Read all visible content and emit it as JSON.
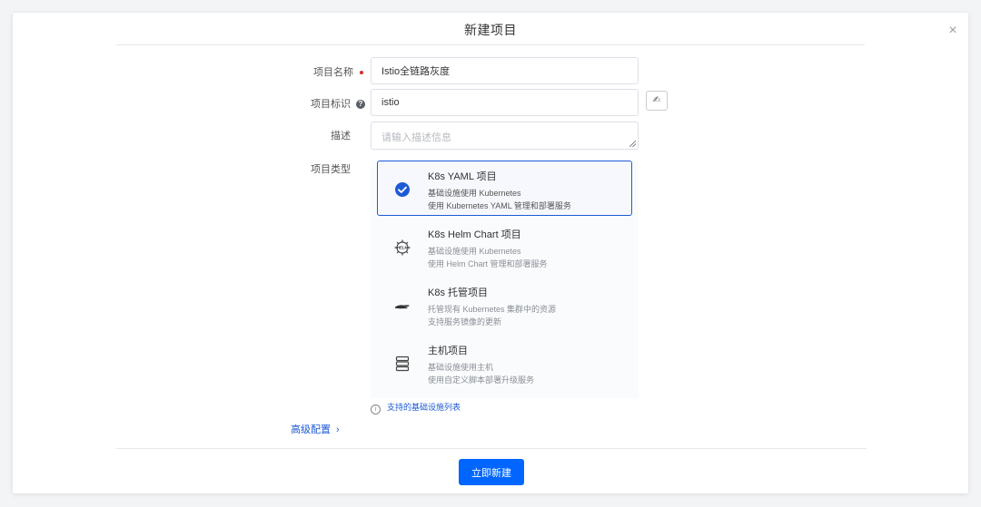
{
  "dialog": {
    "title": "新建项目",
    "close_icon": "×"
  },
  "form": {
    "name": {
      "label": "项目名称",
      "value": "Istio全链路灰度"
    },
    "key": {
      "label": "项目标识",
      "value": "istio",
      "help_icon": "?",
      "generate_icon": "✍"
    },
    "desc": {
      "label": "描述",
      "placeholder": "请输入描述信息"
    },
    "type": {
      "label": "项目类型"
    }
  },
  "project_types": [
    {
      "title": "K8s YAML 项目",
      "line1": "基础设施使用 Kubernetes",
      "line2": "使用 Kubernetes YAML 管理和部署服务",
      "icon": "check-circle-icon",
      "selected": true
    },
    {
      "title": "K8s Helm Chart 项目",
      "line1": "基础设施使用 Kubernetes",
      "line2": "使用 Helm Chart 管理和部署服务",
      "icon": "helm-icon",
      "selected": false
    },
    {
      "title": "K8s 托管项目",
      "line1": "托管现有 Kubernetes 集群中的资源",
      "line2": "支持服务镜像的更新",
      "icon": "hand-icon",
      "selected": false
    },
    {
      "title": "主机项目",
      "line1": "基础设施使用主机",
      "line2": "使用自定义脚本部署升级服务",
      "icon": "server-icon",
      "selected": false
    }
  ],
  "links": {
    "infra_list": "支持的基础设施列表",
    "advanced": "高级配置",
    "advanced_chevron": "›"
  },
  "actions": {
    "submit": "立即新建"
  },
  "colors": {
    "primary": "#0066ff",
    "link": "#1d5ad6",
    "required": "#d32f2f"
  }
}
